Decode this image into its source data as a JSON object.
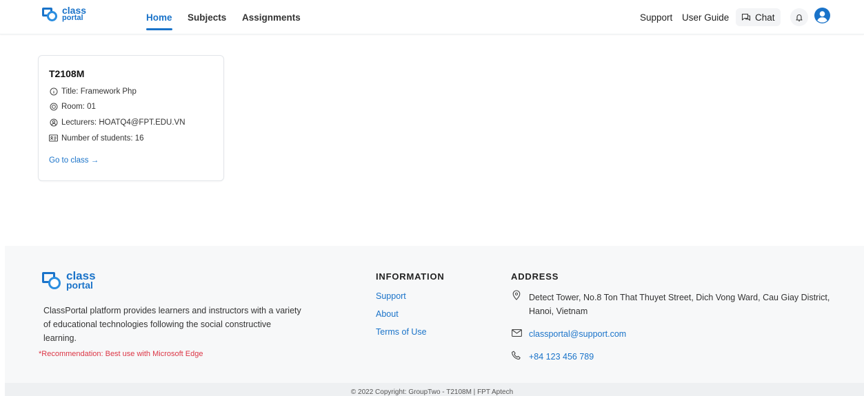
{
  "header": {
    "logo": {
      "line1": "class",
      "line2": "portal"
    },
    "nav": {
      "home": "Home",
      "subjects": "Subjects",
      "assignments": "Assignments"
    },
    "right": {
      "support": "Support",
      "user_guide": "User Guide",
      "chat": "Chat"
    },
    "icons": {
      "chat": "chat-bubble-icon",
      "bell": "bell-icon",
      "avatar": "user-avatar-icon"
    }
  },
  "class_card": {
    "code": "T2108M",
    "title": "Title: Framework Php",
    "room": "Room: 01",
    "lecturers": "Lecturers: HOATQ4@FPT.EDU.VN",
    "students": "Number of students: 16",
    "link": "Go to class →"
  },
  "footer": {
    "logo": {
      "line1": "class",
      "line2": "portal"
    },
    "description": "ClassPortal platform provides learners and instructors with a variety of educational technologies following the social constructive learning.",
    "recommendation": "*Recommendation: Best use with Microsoft Edge",
    "information": {
      "title": "INFORMATION",
      "links": [
        "Support",
        "About",
        "Terms of Use"
      ]
    },
    "address": {
      "title": "ADDRESS",
      "location": "Detect Tower, No.8 Ton That Thuyet Street, Dich Vong Ward, Cau Giay District, Hanoi, Vietnam",
      "email": "classportal@support.com",
      "phone": "+84 123 456 789"
    },
    "copyright": "© 2022 Copyright: GroupTwo - T2108M | FPT Aptech"
  },
  "colors": {
    "brand": "#1a73c9",
    "recommendation": "#dc3545",
    "footer_bg": "#f7f8f9"
  }
}
